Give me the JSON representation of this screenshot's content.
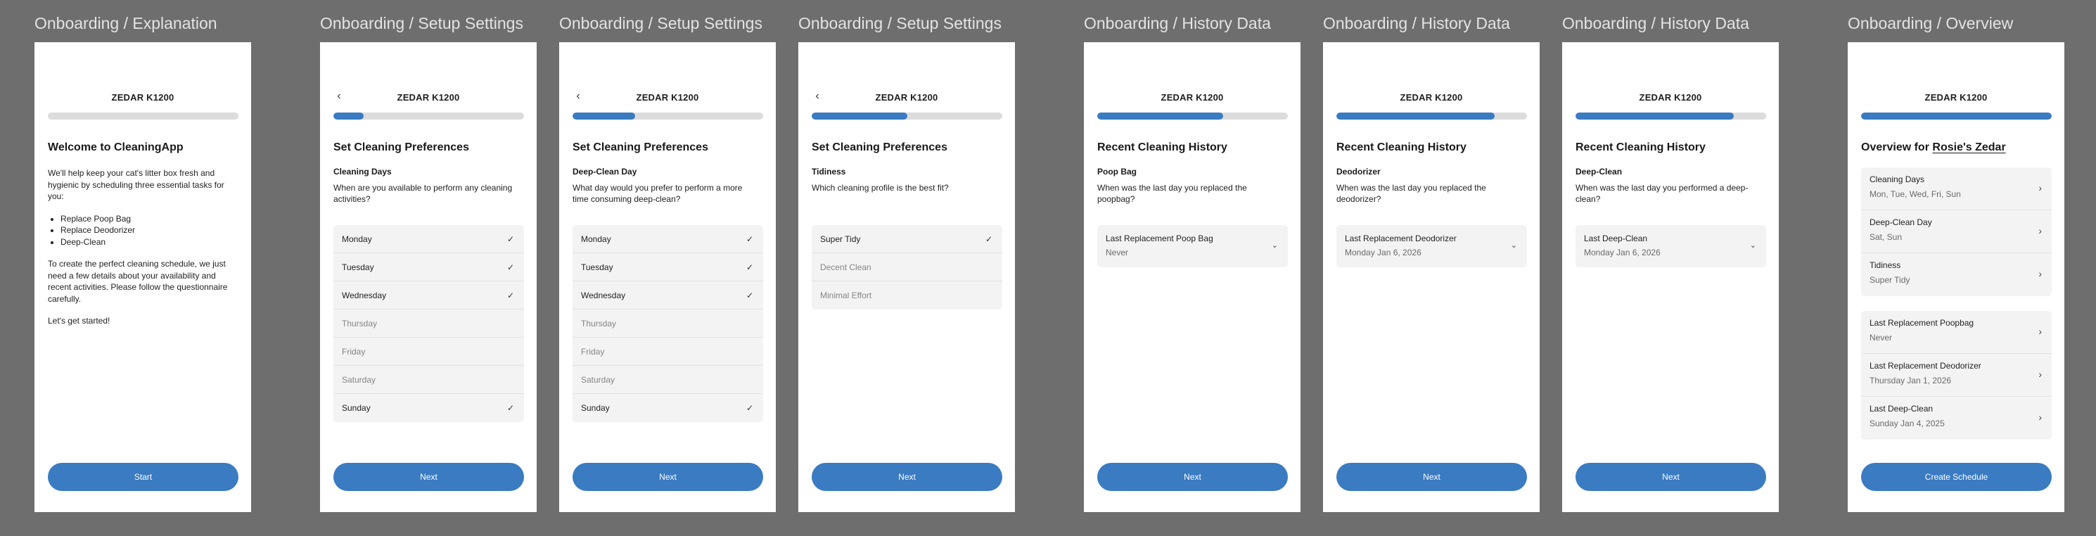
{
  "brand": "ZEDAR K1200",
  "icons": {
    "back": "chevron-left-icon",
    "check": "check-icon",
    "dropdown": "chevron-down-icon",
    "row": "chevron-right-icon"
  },
  "colors": {
    "background": "#6e6e6e",
    "accent": "#3a7bc2",
    "track": "#dcdcdc",
    "card": "#f3f3f3"
  },
  "frames": [
    {
      "title": "Onboarding / Explanation",
      "progress": 0,
      "heading": "Welcome to CleaningApp",
      "intro_p1": "We'll help keep your cat's litter box fresh and hygienic by scheduling three essential tasks for you:",
      "bullets": [
        "Replace Poop Bag",
        "Replace Deodorizer",
        "Deep-Clean"
      ],
      "intro_p2": "To create the perfect cleaning schedule, we just need a few details about your availability and recent activities. Please follow the questionnaire carefully.",
      "intro_p3": "Let's get started!",
      "cta": "Start"
    },
    {
      "title": "Onboarding / Setup Settings",
      "progress": 0.16,
      "heading": "Set Cleaning Preferences",
      "question_label": "Cleaning Days",
      "question_text": "When are you available to perform any cleaning activities?",
      "options": [
        {
          "label": "Monday",
          "selected": true
        },
        {
          "label": "Tuesday",
          "selected": true
        },
        {
          "label": "Wednesday",
          "selected": true
        },
        {
          "label": "Thursday",
          "selected": false
        },
        {
          "label": "Friday",
          "selected": false
        },
        {
          "label": "Saturday",
          "selected": false
        },
        {
          "label": "Sunday",
          "selected": true
        }
      ],
      "cta": "Next"
    },
    {
      "title": "Onboarding / Setup Settings",
      "progress": 0.33,
      "heading": "Set Cleaning Preferences",
      "question_label": "Deep-Clean Day",
      "question_text": "What day would you prefer to perform a more time consuming deep-clean?",
      "options": [
        {
          "label": "Monday",
          "selected": true
        },
        {
          "label": "Tuesday",
          "selected": true
        },
        {
          "label": "Wednesday",
          "selected": true
        },
        {
          "label": "Thursday",
          "selected": false
        },
        {
          "label": "Friday",
          "selected": false
        },
        {
          "label": "Saturday",
          "selected": false
        },
        {
          "label": "Sunday",
          "selected": true
        }
      ],
      "cta": "Next"
    },
    {
      "title": "Onboarding / Setup Settings",
      "progress": 0.5,
      "heading": "Set Cleaning Preferences",
      "question_label": "Tidiness",
      "question_text": "Which cleaning profile is the best fit?",
      "options": [
        {
          "label": "Super Tidy",
          "selected": true
        },
        {
          "label": "Decent Clean",
          "selected": false
        },
        {
          "label": "Minimal Effort",
          "selected": false
        }
      ],
      "cta": "Next"
    },
    {
      "title": "Onboarding / History Data",
      "progress": 0.66,
      "heading": "Recent Cleaning History",
      "question_label": "Poop Bag",
      "question_text": "When was the last day you replaced the poopbag?",
      "dropdown_label": "Last Replacement Poop Bag",
      "dropdown_value": "Never",
      "cta": "Next"
    },
    {
      "title": "Onboarding / History Data",
      "progress": 0.83,
      "heading": "Recent Cleaning History",
      "question_label": "Deodorizer",
      "question_text": "When was the last day you replaced the deodorizer?",
      "dropdown_label": "Last Replacement Deodorizer",
      "dropdown_value": "Monday Jan 6, 2026",
      "cta": "Next"
    },
    {
      "title": "Onboarding / History Data",
      "progress": 0.83,
      "heading": "Recent Cleaning History",
      "question_label": "Deep-Clean",
      "question_text": "When was the last day you performed a deep-clean?",
      "dropdown_label": "Last Deep-Clean",
      "dropdown_value": "Monday Jan 6, 2026",
      "cta": "Next"
    },
    {
      "title": "Onboarding / Overview",
      "progress": 1,
      "heading_prefix": "Overview for",
      "heading_name": "Rosie's Zedar",
      "group1": [
        {
          "label": "Cleaning Days",
          "value": "Mon, Tue, Wed, Fri, Sun"
        },
        {
          "label": "Deep-Clean Day",
          "value": "Sat, Sun"
        },
        {
          "label": "Tidiness",
          "value": "Super Tidy"
        }
      ],
      "group2": [
        {
          "label": "Last Replacement Poopbag",
          "value": "Never"
        },
        {
          "label": "Last Replacement Deodorizer",
          "value": "Thursday Jan 1, 2026"
        },
        {
          "label": "Last Deep-Clean",
          "value": "Sunday Jan 4, 2025"
        }
      ],
      "cta": "Create Schedule"
    }
  ]
}
